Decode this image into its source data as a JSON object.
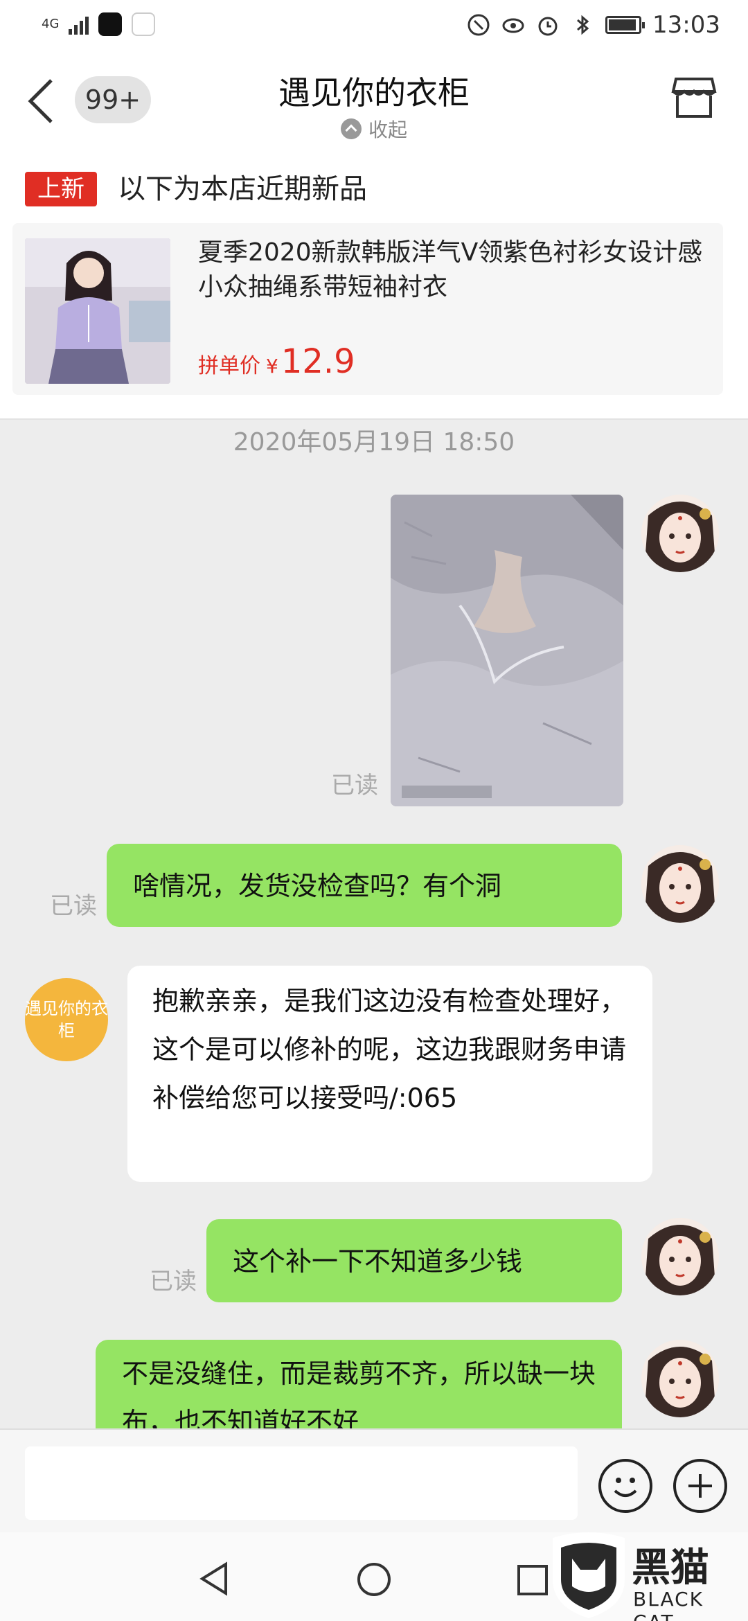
{
  "status_bar": {
    "network": "4G",
    "time": "13:03",
    "battery_level": 0.85
  },
  "header": {
    "title": "遇见你的衣柜",
    "unread_badge": "99+",
    "collapse_label": "收起"
  },
  "new_products": {
    "tag": "上新",
    "heading": "以下为本店近期新品",
    "product": {
      "name": "夏季2020新款韩版洋气V领紫色衬衫女设计感小众抽绳系带短袖衬衣",
      "price_label": "拼单价",
      "currency": "¥",
      "price": "12.9"
    }
  },
  "chat": {
    "timestamp": "2020年05月19日 18:50",
    "messages": [
      {
        "read": "已读"
      },
      {
        "text": "啥情况，发货没检查吗？有个洞",
        "read": "已读"
      },
      {
        "sender": "遇见你的衣柜",
        "text": "抱歉亲亲，是我们这边没有检查处理好，这个是可以修补的呢，这边我跟财务申请补偿给您可以接受吗/:065"
      },
      {
        "text": "这个补一下不知道多少钱",
        "read": "已读"
      },
      {
        "text": "不是没缝住，而是裁剪不齐，所以缺一块布，也不知道好不好"
      }
    ]
  },
  "input": {
    "placeholder": ""
  },
  "icons": {
    "back": "chevron-left-icon",
    "store": "store-icon",
    "emoji": "smiley-icon",
    "more": "plus-icon"
  },
  "watermark": {
    "brand_cn": "黑猫",
    "brand_en": "BLACK CAT"
  },
  "colors": {
    "accent_red": "#e02e24",
    "my_bubble": "#95e463",
    "shop_avatar": "#f4b63d"
  }
}
